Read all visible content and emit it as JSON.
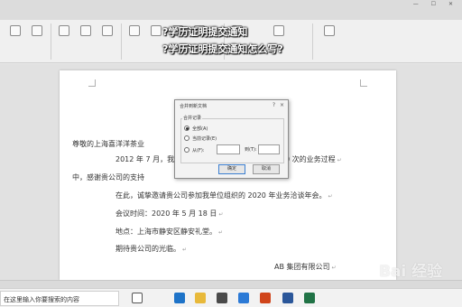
{
  "headline": {
    "line1": "?学历证明提交通知",
    "line2": "?学历证明提交通知怎么写?"
  },
  "document": {
    "lines": [
      "尊敬的上海喜洋洋茶业",
      "2012 年 7 月，我",
      "0 次的业务过程",
      "中，感谢贵公司的支持",
      "在此，诚挚邀请贵公司参加我单位组织的 2020 年业务洽谈年会。",
      "会议时间：2020 年 5 月 18 日",
      "地点：上海市静安区静安礼堂。",
      "期待贵公司的光临。",
      "AB 集团有限公司"
    ],
    "return_mark": "↵"
  },
  "dialog": {
    "title": "合并到新文档",
    "help": "?",
    "close": "×",
    "group_label": "合并记录",
    "options": [
      "全部(A)",
      "当前记录(E)",
      "从(F):"
    ],
    "to_label": "到(T):",
    "ok_label": "确定",
    "cancel_label": "取消"
  },
  "taskbar": {
    "search_text": "在这里输入你要搜索的内容"
  },
  "watermark": {
    "text": "Bai 经验"
  },
  "colors": {
    "accent": "#3c7fd1",
    "word_blue": "#2b579a",
    "excel_green": "#217346"
  }
}
